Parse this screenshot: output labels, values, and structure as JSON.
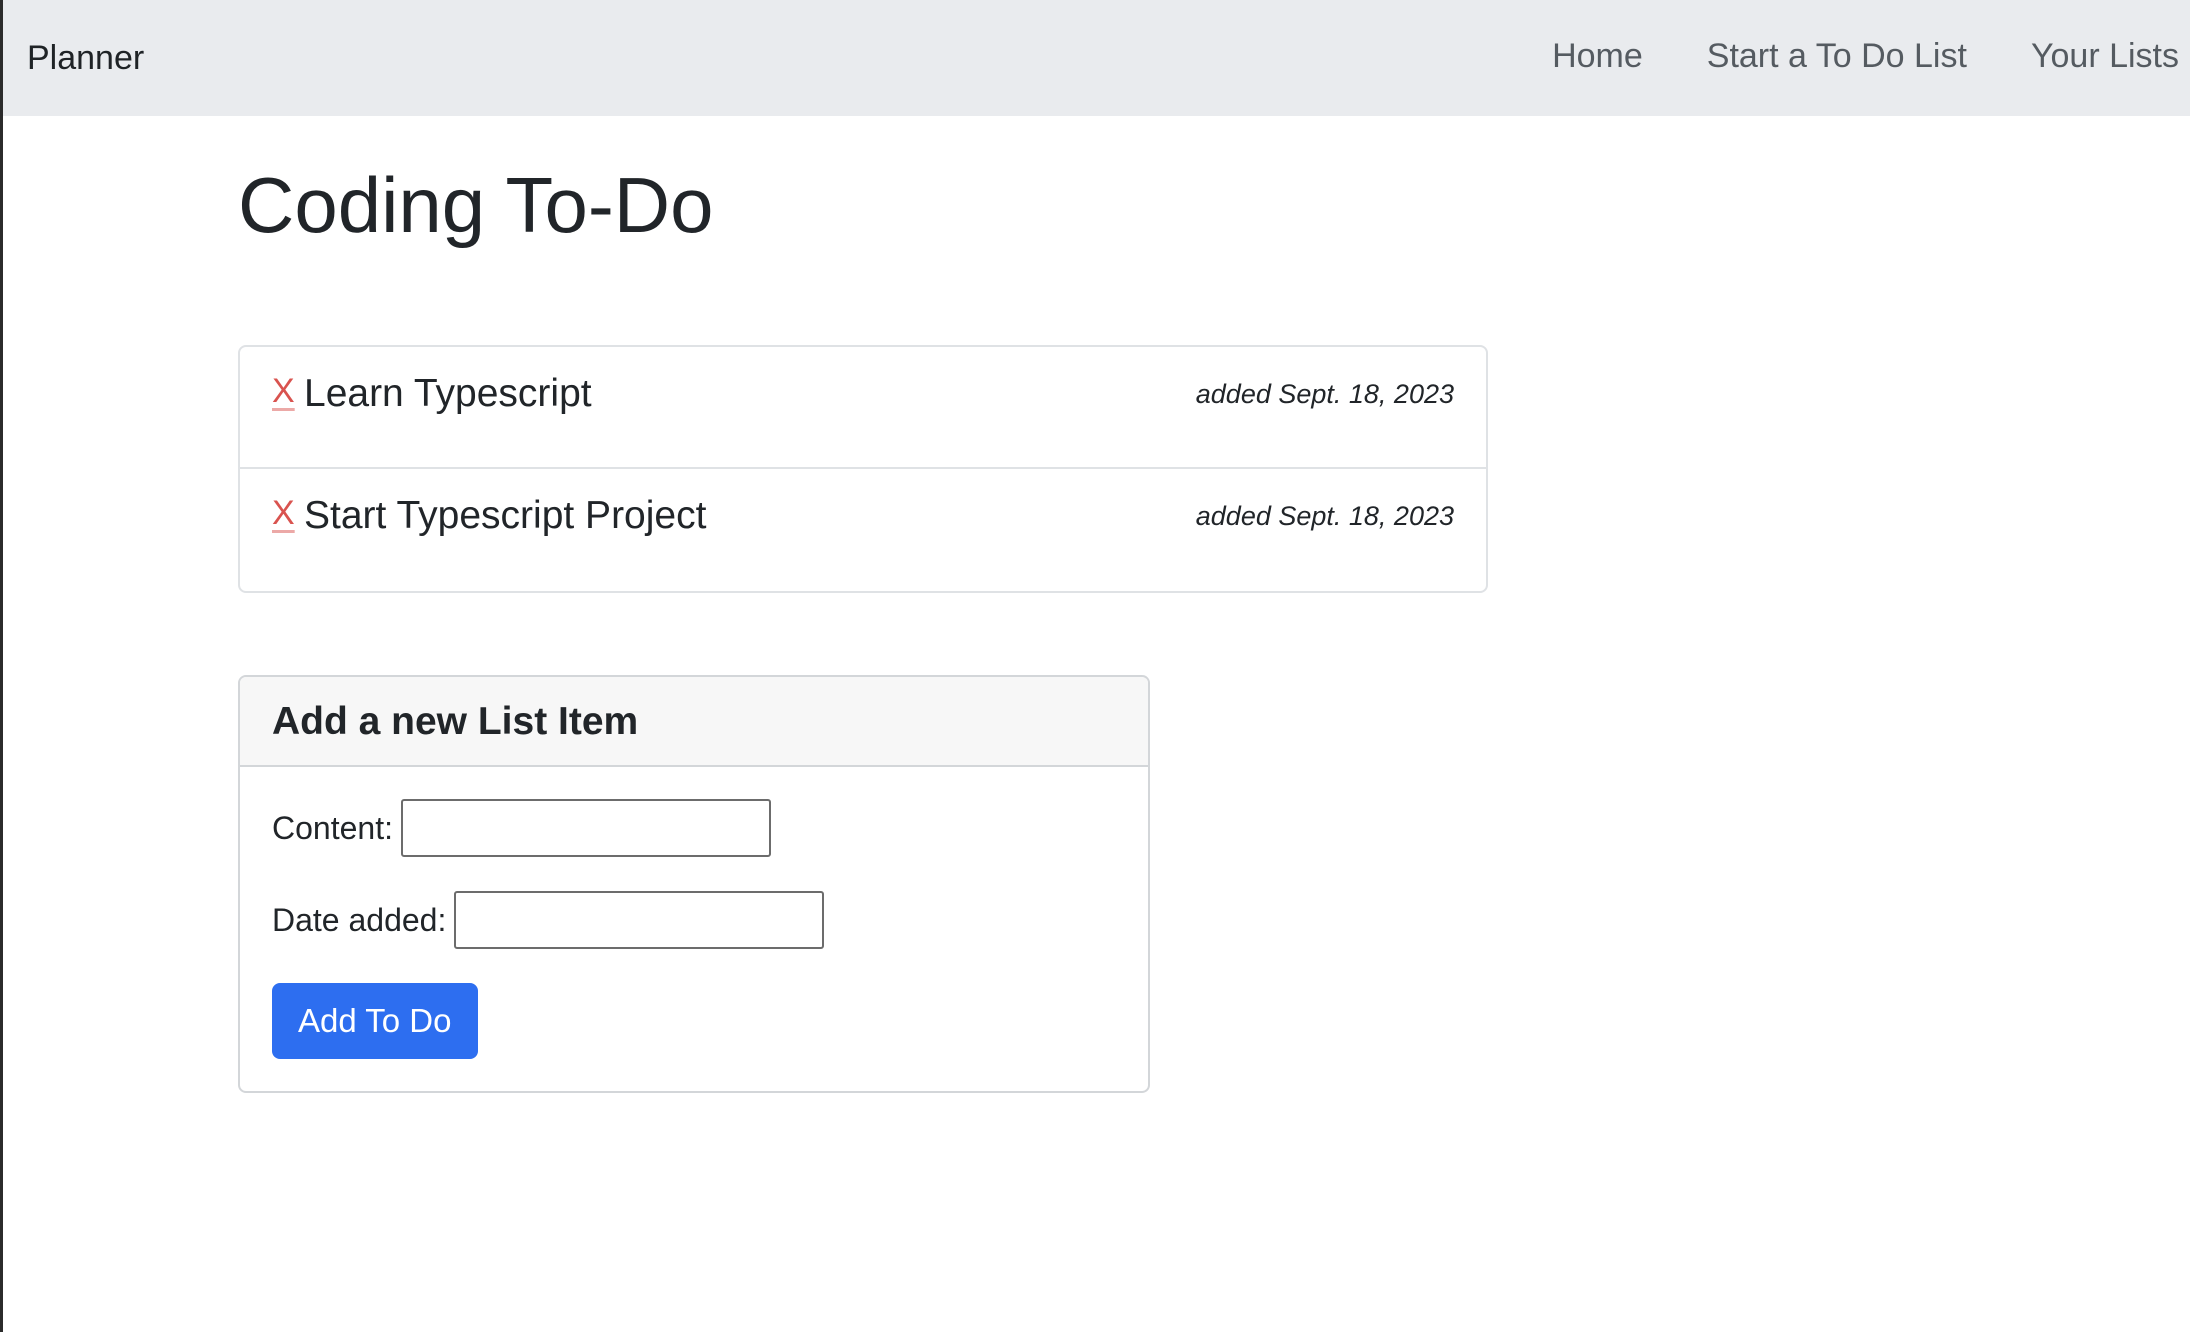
{
  "navbar": {
    "brand": "Planner",
    "links": [
      {
        "label": "Home"
      },
      {
        "label": "Start a To Do List"
      },
      {
        "label": "Your Lists"
      }
    ]
  },
  "page": {
    "title": "Coding To-Do"
  },
  "todo_items": [
    {
      "delete_label": "X",
      "content": "Learn Typescript",
      "date": "added Sept. 18, 2023"
    },
    {
      "delete_label": "X",
      "content": "Start Typescript Project",
      "date": "added Sept. 18, 2023"
    }
  ],
  "add_form": {
    "title": "Add a new List Item",
    "content_label": "Content:",
    "content_value": "",
    "date_label": "Date added:",
    "date_value": "",
    "submit_label": "Add To Do"
  },
  "colors": {
    "navbar_bg": "#e9ebee",
    "primary": "#2d6ef0",
    "delete": "#d9534f"
  }
}
